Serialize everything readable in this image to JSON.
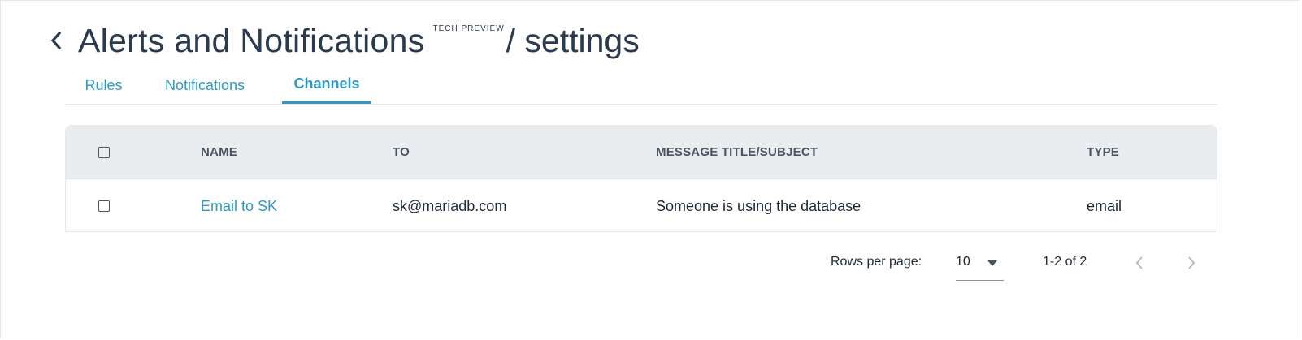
{
  "header": {
    "title": "Alerts and Notifications",
    "badge": "TECH PREVIEW",
    "subtitle": "/ settings",
    "back_icon": "chevron-left-icon"
  },
  "tabs": [
    {
      "label": "Rules",
      "active": false
    },
    {
      "label": "Notifications",
      "active": false
    },
    {
      "label": "Channels",
      "active": true
    }
  ],
  "table": {
    "columns": [
      "NAME",
      "TO",
      "MESSAGE TITLE/SUBJECT",
      "TYPE"
    ],
    "rows": [
      {
        "name": "Email to SK",
        "to": "sk@mariadb.com",
        "subject": "Someone is using the database",
        "type": "email"
      }
    ]
  },
  "pagination": {
    "rows_per_page_label": "Rows per page:",
    "rows_per_page_value": "10",
    "range": "1-2 of 2",
    "prev_icon": "chevron-left-icon",
    "next_icon": "chevron-right-icon"
  },
  "colors": {
    "accent": "#2f99c2",
    "header_bg": "#e9edf0",
    "title": "#2a3b4f"
  }
}
